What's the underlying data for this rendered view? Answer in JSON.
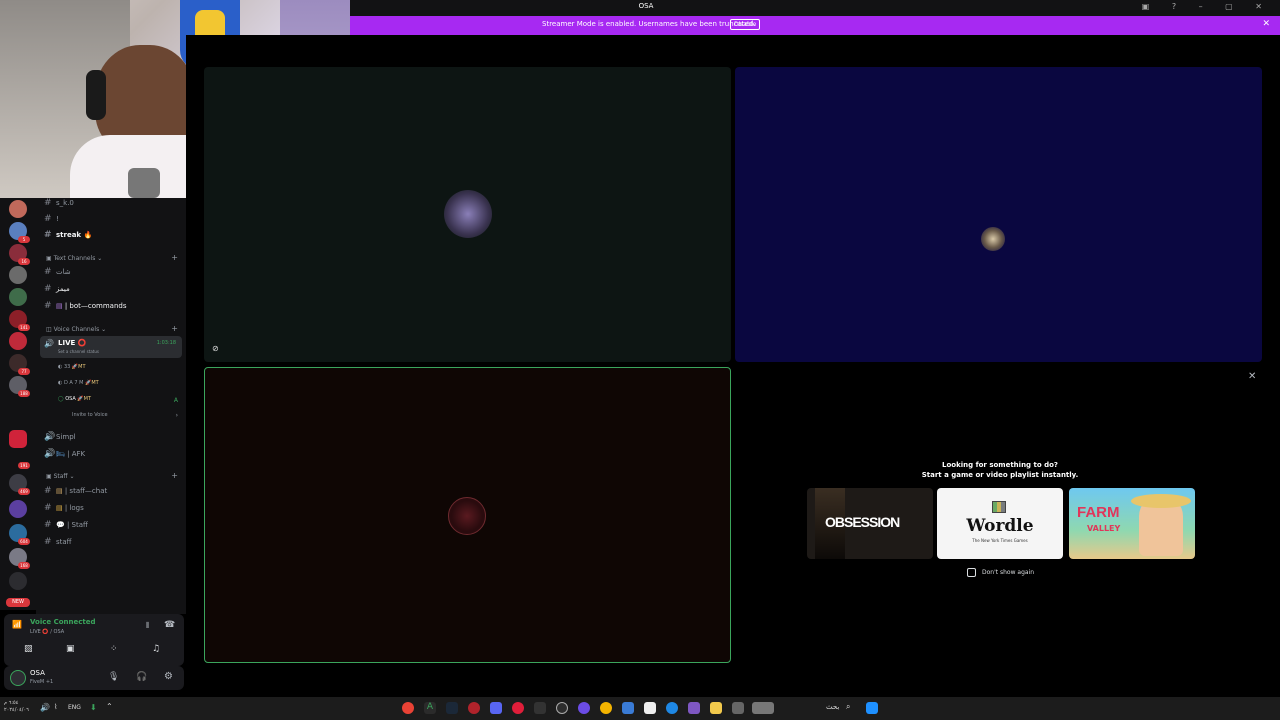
{
  "titlebar": {
    "title": "OSA"
  },
  "banner": {
    "text": "Streamer Mode is enabled. Usernames have been truncated.",
    "disable_label": "Disable"
  },
  "channels": {
    "top_items": [
      "s_k.0",
      "!"
    ],
    "streak": "streak 🔥",
    "text_category": "Text Channels",
    "text_items": [
      "شات",
      "ميمز",
      "| bot—commands"
    ],
    "voice_category": "Voice Channels",
    "live_channel": "LIVE ⭕",
    "live_timer": "1:03:18",
    "channel_status": "Set a channel status",
    "voice_users": [
      "33",
      "D A 7 M",
      "OSA"
    ],
    "invite": "Invite to Voice",
    "simpl": "Simpl",
    "afk": "| AFK",
    "staff_category": "Staff",
    "staff_items": [
      "| staff—chat",
      "| logs",
      "| Staff",
      "staff"
    ]
  },
  "server_badges": [
    "5",
    "16",
    "141",
    "77",
    "188",
    "191",
    "469",
    "604",
    "168"
  ],
  "new_badge": "NEW",
  "voice_panel": {
    "status": "Voice Connected",
    "channel": "LIVE ⭕ / OSA"
  },
  "user_panel": {
    "name": "OSA",
    "status": "FiveM +1"
  },
  "activity": {
    "heading": "Looking for something to do?",
    "subheading": "Start a game or video playlist instantly.",
    "games": [
      "OBSESSION",
      "Wordle",
      "FARM"
    ],
    "wordle_sub": "The New York Times Games",
    "farm_sub": "VALLEY",
    "dont_show": "Don't show again"
  },
  "taskbar": {
    "lang": "ENG",
    "search_placeholder": "بحث",
    "clock_time": "٦:٥٤ م",
    "clock_date": "٢٠٢٤/٠٤/٠٦"
  },
  "colors": {
    "banner": "#a729f2",
    "tile_top_left": "#0d1513",
    "tile_top_right": "#0a0740",
    "tile_bottom_left": "#0f0604",
    "speaking_border": "#3ba55c"
  }
}
